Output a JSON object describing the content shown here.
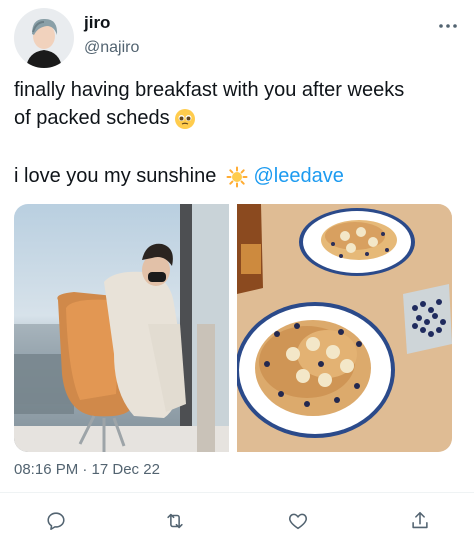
{
  "tweet": {
    "author_name": "jiro",
    "author_handle": "@najiro",
    "text_line_1": "finally having breakfast with you after weeks",
    "text_line_2": "of packed scheds",
    "text_line_3": "i love you my sunshine",
    "mention": "@leedave",
    "timestamp": "08:16 PM · 17 Dec 22"
  },
  "icons": {
    "more": "more-icon",
    "pleading_emoji": "pleading-face-emoji",
    "sun_emoji": "sun-emoji",
    "reply": "reply-icon",
    "retweet": "retweet-icon",
    "like": "heart-icon",
    "share": "share-icon"
  },
  "colors": {
    "text": "#0f1419",
    "secondary": "#536471",
    "link": "#1d9bf0",
    "divider": "#eff3f4"
  }
}
